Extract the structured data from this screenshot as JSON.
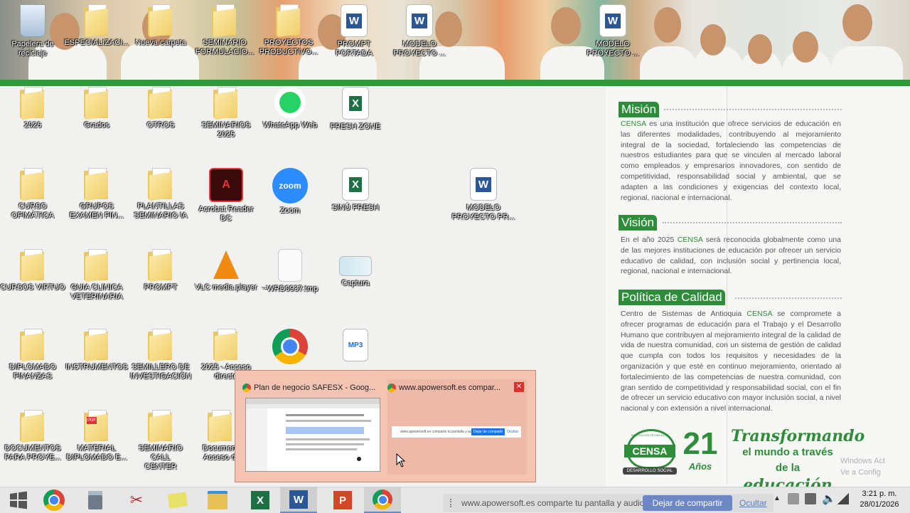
{
  "top_icons": [
    {
      "label": "Papelera de\nreciclaje",
      "kind": "recycle"
    },
    {
      "label": "ESPECIALIZACI...",
      "kind": "folder"
    },
    {
      "label": "Nueva carpeta",
      "kind": "folder"
    },
    {
      "label": "SEMINARIO\nFORMULACIO...",
      "kind": "folder"
    },
    {
      "label": "PROYECTOS\nPRODUCTIVO...",
      "kind": "folder"
    },
    {
      "label": "PROMPT\nPORTADA",
      "kind": "word"
    },
    {
      "label": "MODELO\nPROYECTO ...",
      "kind": "word"
    },
    {
      "label": "MODELO\nPROYECTO ...",
      "kind": "word"
    }
  ],
  "desktop_icons": [
    {
      "label": "2026",
      "kind": "folder"
    },
    {
      "label": "Grados",
      "kind": "folder"
    },
    {
      "label": "OTROS",
      "kind": "folder"
    },
    {
      "label": "SEMINARIOS\n2025",
      "kind": "folder"
    },
    {
      "label": "WhatsApp Web",
      "kind": "whatsapp"
    },
    {
      "label": "FRESH ZONE",
      "kind": "excel"
    },
    {
      "label": "CURSO\nOFIMÁTICA",
      "kind": "folder"
    },
    {
      "label": "GRUPOS\nEXAMEN FIN...",
      "kind": "folder"
    },
    {
      "label": "PLANTILLAS\nSEMINARIO IA",
      "kind": "folder"
    },
    {
      "label": "Acrobat Reader\nDC",
      "kind": "acrobat"
    },
    {
      "label": "Zoom",
      "kind": "zoom"
    },
    {
      "label": "SINÚ FRESH",
      "kind": "excel"
    },
    {
      "label": "MODELO\nPROYECTO PR...",
      "kind": "word"
    },
    {
      "label": "CURSOS VIRTUO",
      "kind": "folder"
    },
    {
      "label": "GUIA CLINICA\nVETERINARIA",
      "kind": "folder"
    },
    {
      "label": "PROMPT",
      "kind": "folder"
    },
    {
      "label": "VLC media player",
      "kind": "vlc"
    },
    {
      "label": "~WRD0937.tmp",
      "kind": "file"
    },
    {
      "label": "Captura",
      "kind": "image"
    },
    {
      "label": "DIPLOMADO\nFINANZAS",
      "kind": "folder"
    },
    {
      "label": "INSTRUMENTOS",
      "kind": "folder"
    },
    {
      "label": "SEMILLERO DE\nINVESTIGACIÓN",
      "kind": "folder"
    },
    {
      "label": "2025 - Acceso\ndirecto",
      "kind": "folder"
    },
    {
      "label": "",
      "kind": "chrome"
    },
    {
      "label": "",
      "kind": "mp3"
    },
    {
      "label": "DOCUMENTOS\nPARA PROYE...",
      "kind": "folder"
    },
    {
      "label": "MATERIAL\nDIPLOMADO E...",
      "kind": "pdf"
    },
    {
      "label": "SEMINARIO CALL\nCENTER",
      "kind": "folder"
    },
    {
      "label": "Document\nAcceso di",
      "kind": "folder"
    }
  ],
  "wallpaper": {
    "mision_title": "Misión",
    "mision_brand": "CENSA",
    "mision_text": " es una institución que ofrece servicios de educación en las diferentes modalidades, contribuyendo al mejoramiento integral de la sociedad, fortaleciendo las competencias de nuestros estudiantes para que se vinculen al mercado laboral como empleados y empresarios innovadores, con sentido de competitividad, responsabilidad social y ambiental, que se adapten a las condiciones y exigencias del contexto local, regional, nacional e internacional.",
    "vision_title": "Visión",
    "vision_pre": "En el año 2025 ",
    "vision_brand": "CENSA",
    "vision_text": " será reconocida globalmente como una de las mejores instituciones de educación por ofrecer un servicio educativo de calidad, con inclusión social y pertinencia local, regional, nacional e internacional.",
    "calidad_title": "Política de Calidad",
    "calidad_pre": "Centro de Sistemas de Antioquia ",
    "calidad_brand": "CENSA",
    "calidad_text": " se compromete a ofrecer programas de educación para el Trabajo y el Desarrollo Humano que contribuyen al mejoramiento integral de la calidad de vida de nuestra comunidad, con un sistema de gestión de calidad que cumpla con todos los requisitos y necesidades de la organización y que esté en continuo mejoramiento, orientado al fortalecimiento de las competencias de nuestra comunidad, con gran sentido de competitividad y responsabilidad social, con el fin de ofrecer un servicio educativo con mayor inclusión social, a nivel nacional y con extensión a nivel internacional.",
    "logo_text": "CENSA",
    "logo_top": "INSTITUCIÓN TÉCNICA LABORAL",
    "logo_bottom": "DESARROLLO SOCIAL",
    "years_num": "21",
    "years_label": "Años",
    "slogan_1": "Transformando",
    "slogan_2": "el mundo a través",
    "slogan_3": "de la ",
    "slogan_4": "educación",
    "activate_1": "Windows Act",
    "activate_2": "Ve a Config"
  },
  "popup": {
    "thumb1_title": "Plan de negocio SAFESX - Goog...",
    "thumb2_title": "www.apowersoft.es compar...",
    "thumb2_bar_text": "www.apowersoft.es comparte tu pantalla y audio.",
    "thumb2_stop": "Dejar de compartir",
    "thumb2_hide": "Ocultar"
  },
  "share_bar": {
    "text": "www.apowersoft.es comparte tu pantalla y audio.",
    "stop": "Dejar de compartir",
    "hide": "Ocultar"
  },
  "clock": {
    "time": "3:21 p. m.",
    "date": "28/01/2026"
  },
  "colors": {
    "censa_green": "#2e8d3a",
    "taskbar": "#e7e7e7",
    "popup": "#f4c4b3"
  }
}
